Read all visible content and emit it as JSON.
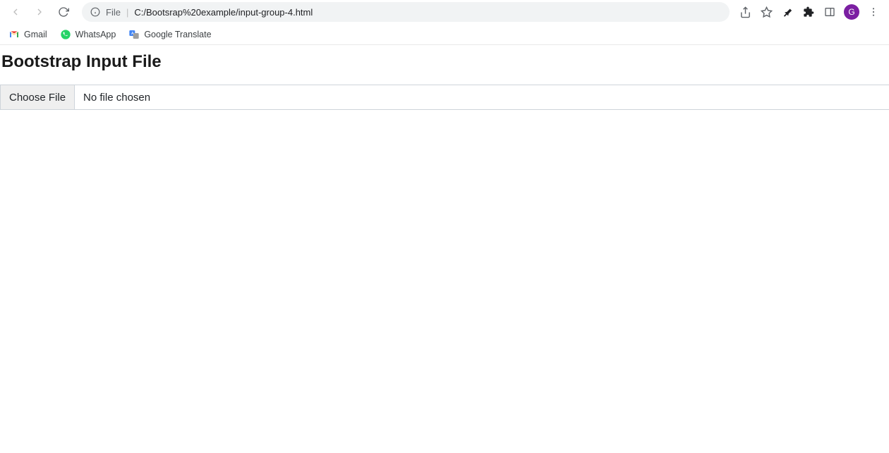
{
  "browser": {
    "address": {
      "scheme_label": "File",
      "url": "C:/Bootsrap%20example/input-group-4.html"
    },
    "profile_initial": "G"
  },
  "bookmarks": {
    "items": [
      {
        "label": "Gmail"
      },
      {
        "label": "WhatsApp"
      },
      {
        "label": "Google Translate"
      }
    ]
  },
  "page": {
    "title": "Bootstrap Input File",
    "file_input": {
      "button_label": "Choose File",
      "status_text": "No file chosen"
    }
  }
}
